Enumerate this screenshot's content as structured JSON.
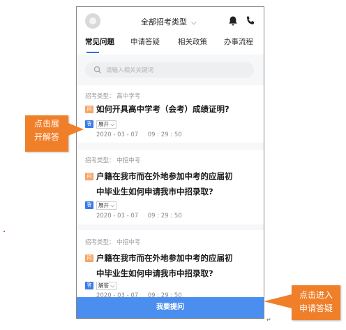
{
  "header": {
    "title": "全部招考类型",
    "title_chevron": "⌵",
    "icons": [
      "avatar",
      "bell-icon",
      "phone-icon"
    ]
  },
  "tabs": [
    {
      "label": "常见问题",
      "active": true
    },
    {
      "label": "申请答疑",
      "active": false
    },
    {
      "label": "相关政策",
      "active": false
    },
    {
      "label": "办事流程",
      "active": false
    }
  ],
  "search": {
    "placeholder": "请输入相关关键词"
  },
  "questions": [
    {
      "category": "招考类型：  高中学考",
      "q_badge": "问",
      "question_lines": [
        "如何开具高中学考（会考）成绩证明?"
      ],
      "a_badge": "答",
      "toggle": "展开 ⌵",
      "datetime": "2020 - 03 - 07     09 : 29 : 50"
    },
    {
      "category": "招考类型：  中招中考",
      "q_badge": "问",
      "question_lines": [
        "户籍在我市而在外地参加中考的应届初",
        "中毕业生如何申请我市中招录取?"
      ],
      "a_badge": "答",
      "toggle": "展开 ⌵",
      "datetime": "2020 - 03 - 07     09 : 29 : 50"
    },
    {
      "category": "招考类型：  中招中考",
      "q_badge": "问",
      "question_lines": [
        "户籍在我市而在外地参加中考的应届初",
        "中毕业生如何申请我市中招录取?"
      ],
      "a_badge": "答",
      "toggle": "解答 ⌵",
      "datetime": "2020 - 03 - 07     09 : 29 : 50"
    }
  ],
  "ask_button": "我要提问",
  "annotations": {
    "callout_expand": [
      "点击展",
      "开解答"
    ],
    "callout_ask": [
      "点击进入",
      "申请答疑"
    ],
    "return_mark": "↵"
  },
  "colors": {
    "accent": "#2e6fe0",
    "ask_button": "#4a8ff0",
    "question_badge": "#f5a76a",
    "answer_badge": "#3b7be8",
    "callout": "#f07f2a"
  }
}
